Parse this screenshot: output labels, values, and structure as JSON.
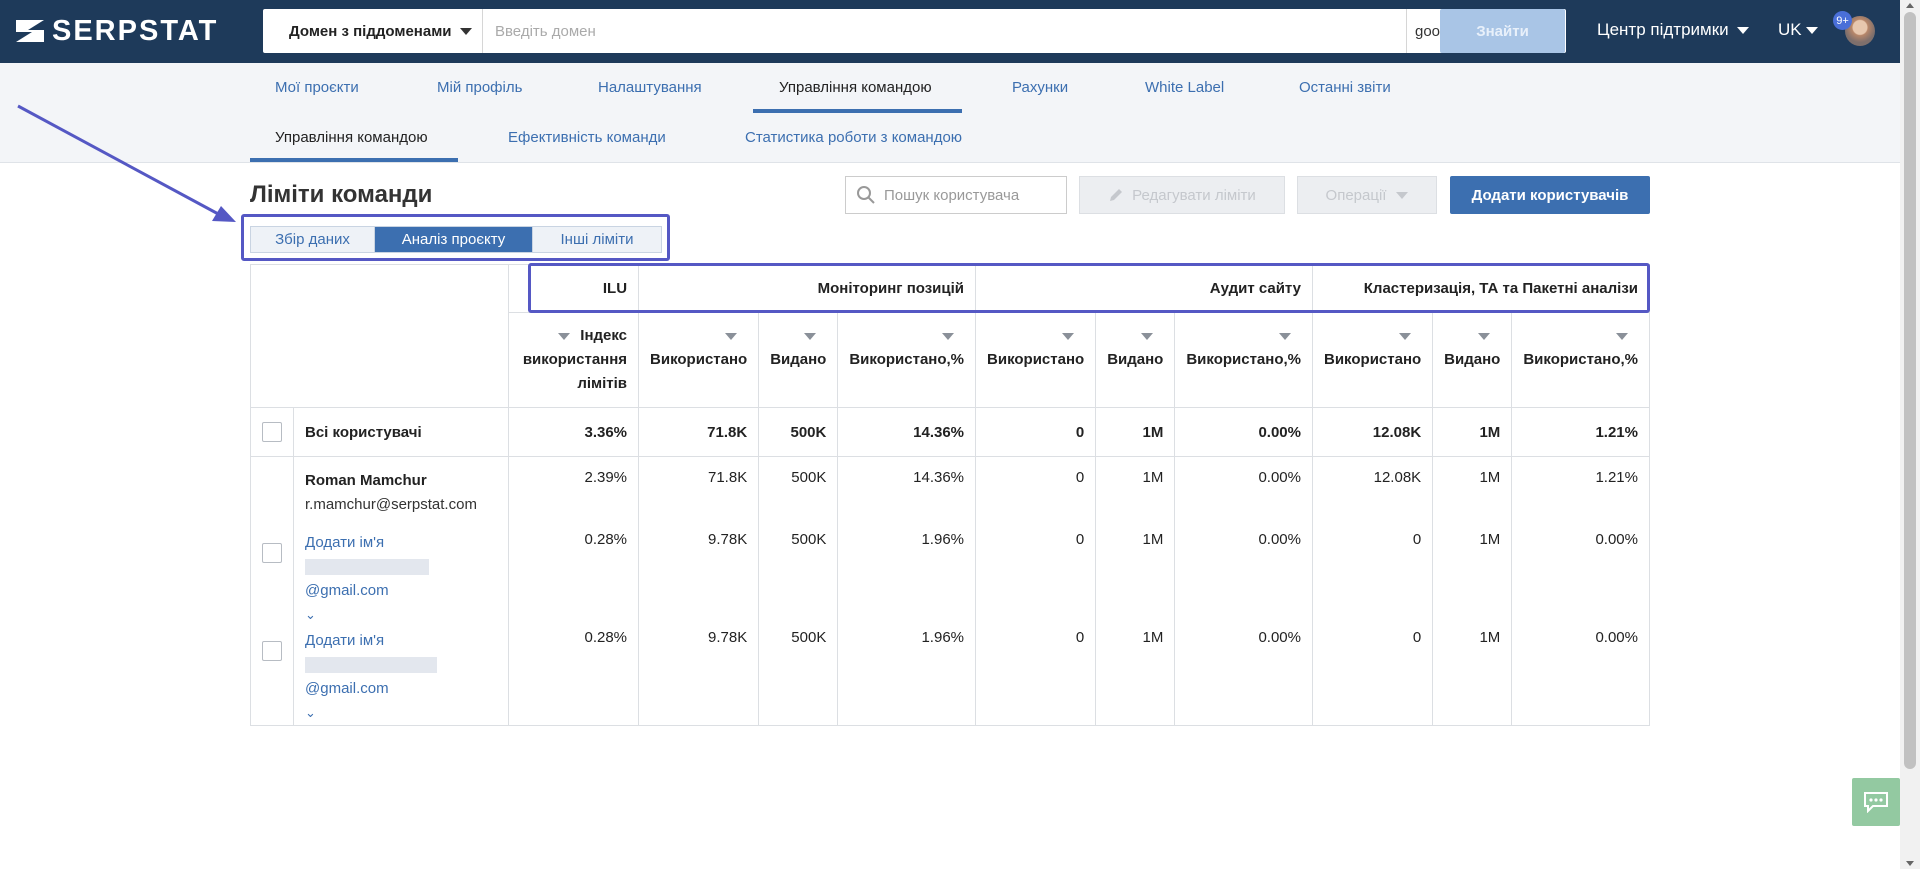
{
  "app": {
    "logo": "SERPSTAT"
  },
  "search": {
    "domain_mode": "Домен з піддоменами",
    "placeholder": "Введіть домен",
    "region": "google.com.ua",
    "find_label": "Знайти"
  },
  "header": {
    "support": "Центр підтримки",
    "language": "UK",
    "notifications": "9+"
  },
  "tabs": [
    "Мої проєкти",
    "Мій профіль",
    "Налаштування",
    "Управління командою",
    "Рахунки",
    "White Label",
    "Останні звіти"
  ],
  "subtabs": [
    "Управління командою",
    "Ефективність команди",
    "Статистика роботи з командою"
  ],
  "page": {
    "title": "Ліміти команди",
    "segments": [
      "Збір даних",
      "Аналіз проєкту",
      "Інші ліміти"
    ],
    "user_search_placeholder": "Пошук користувача",
    "edit_limits": "Редагувати ліміти",
    "operations": "Операції",
    "add_users": "Додати користувачів"
  },
  "table": {
    "groups": [
      "ILU",
      "Моніторинг позицій",
      "Аудит сайту",
      "Кластеризація, ТА та Пакетні аналізи"
    ],
    "ilu_header": [
      "Індекс",
      "використання",
      "лімітів"
    ],
    "columns": [
      "Використано",
      "Видано",
      "Використано,%",
      "Використано",
      "Видано",
      "Використано,%",
      "Використано",
      "Видано",
      "Використано,%"
    ],
    "all_users": {
      "label": "Всі користувачі",
      "values": [
        "3.36%",
        "71.8K",
        "500K",
        "14.36%",
        "0",
        "1M",
        "0.00%",
        "12.08K",
        "1M",
        "1.21%"
      ]
    },
    "users": [
      {
        "name": "Roman Mamchur",
        "email": "r.mamchur@serpstat.com",
        "values": [
          "2.39%",
          "71.8K",
          "500K",
          "14.36%",
          "0",
          "1M",
          "0.00%",
          "12.08K",
          "1M",
          "1.21%"
        ]
      },
      {
        "name": "Додати ім'я",
        "email": "@gmail.com",
        "values": [
          "0.28%",
          "9.78K",
          "500K",
          "1.96%",
          "0",
          "1M",
          "0.00%",
          "0",
          "1M",
          "0.00%"
        ]
      },
      {
        "name": "Додати ім'я",
        "email": "@gmail.com",
        "values": [
          "0.28%",
          "9.78K",
          "500K",
          "1.96%",
          "0",
          "1M",
          "0.00%",
          "0",
          "1M",
          "0.00%"
        ]
      }
    ]
  },
  "colors": {
    "header_bg": "#1e3a5a",
    "accent": "#3c6fb0",
    "annotation": "#5558c4"
  }
}
